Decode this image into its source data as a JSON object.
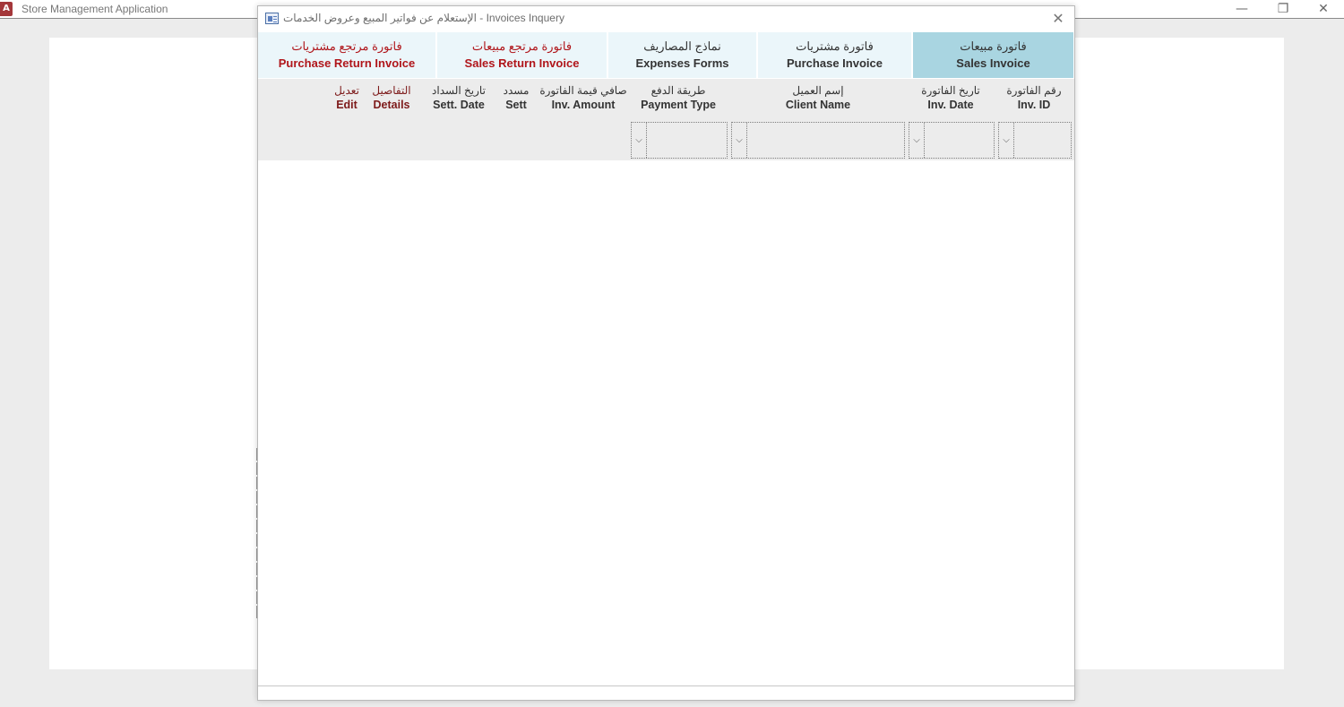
{
  "app": {
    "title": "Store Management Application",
    "logo_letter": "A",
    "minimize_glyph": "—",
    "restore_glyph": "❐",
    "close_glyph": "✕"
  },
  "form": {
    "title": "الإستعلام عن فواتير المبيع وعروض الخدمات - Invoices Inquery",
    "close_glyph": "✕",
    "icon": "form-icon"
  },
  "tabs": [
    {
      "ar": "فاتورة مبيعات",
      "en": "Sales Invoice",
      "active": true
    },
    {
      "ar": "فاتورة مشتريات",
      "en": "Purchase Invoice"
    },
    {
      "ar": "نماذج المصاريف",
      "en": "Expenses Forms"
    },
    {
      "ar": "فاتورة مرتجع مبيعات",
      "en": "Sales Return Invoice"
    },
    {
      "ar": "فاتورة مرتجع مشتريات",
      "en": "Purchase Return Invoice"
    }
  ],
  "columns": [
    {
      "ar": "رقم الفاتورة",
      "en": "Inv. ID"
    },
    {
      "ar": "تاريخ الفاتورة",
      "en": "Inv. Date"
    },
    {
      "ar": "إسم العميل",
      "en": "Client Name"
    },
    {
      "ar": "طريقة الدفع",
      "en": "Payment Type"
    },
    {
      "ar": "صافي قيمة الفاتورة",
      "en": "Inv. Amount"
    },
    {
      "ar": "مسدد",
      "en": "Sett"
    },
    {
      "ar": "تاريخ السداد",
      "en": "Sett. Date"
    },
    {
      "ar": "التفاصيل",
      "en": "Details"
    },
    {
      "ar": "تعديل",
      "en": "Edit"
    }
  ],
  "filters": {
    "chevron_glyph": "⌵",
    "inv_id": "",
    "inv_date": "",
    "client_name": "",
    "payment_type": ""
  },
  "colors": {
    "active_tab": "#a9d5e1",
    "inactive_tab": "#ebf6fa",
    "return_tab_text": "#b0161b",
    "action_header_text": "#7d1a1a",
    "filter_bg": "#ececec"
  }
}
